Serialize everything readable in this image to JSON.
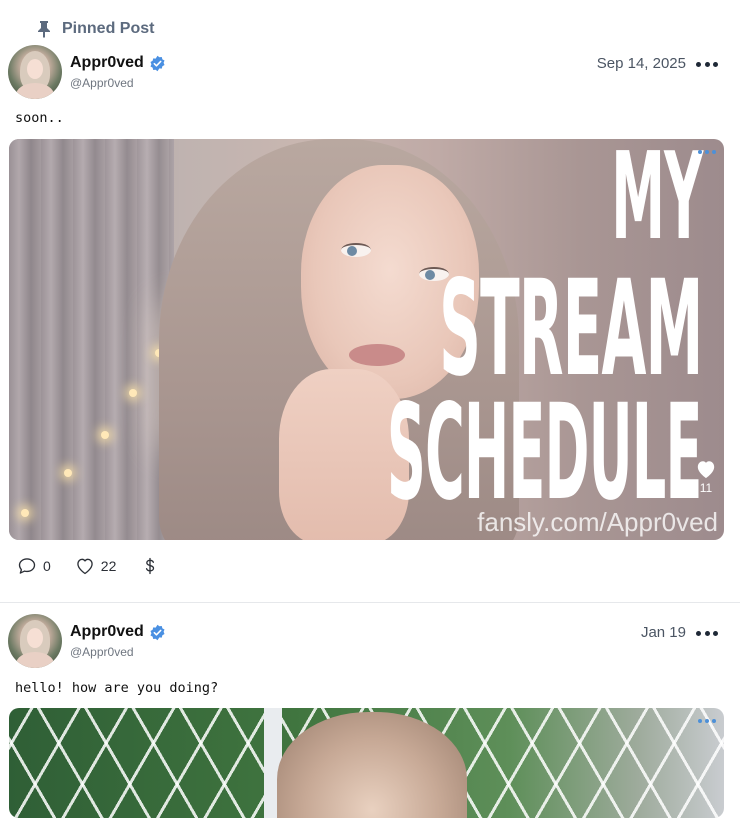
{
  "pinned": {
    "label": "Pinned Post",
    "icon": "pin-icon"
  },
  "posts": [
    {
      "author": {
        "name": "Appr0ved",
        "handle": "@Appr0ved",
        "verified": true
      },
      "date": "Sep 14, 2025",
      "text": "soon..",
      "media": {
        "overlay_lines": [
          "MY",
          "STREAM",
          "SCHEDULE"
        ],
        "watermark": "fansly.com/Appr0ved",
        "like_count": "11"
      },
      "actions": {
        "comments": "0",
        "likes": "22"
      }
    },
    {
      "author": {
        "name": "Appr0ved",
        "handle": "@Appr0ved",
        "verified": true
      },
      "date": "Jan 19",
      "text": "hello! how are you doing?"
    }
  ],
  "colors": {
    "verified_badge": "#4a90e2",
    "muted_text": "#6f7680",
    "accent_dots": "#4d90d8"
  }
}
